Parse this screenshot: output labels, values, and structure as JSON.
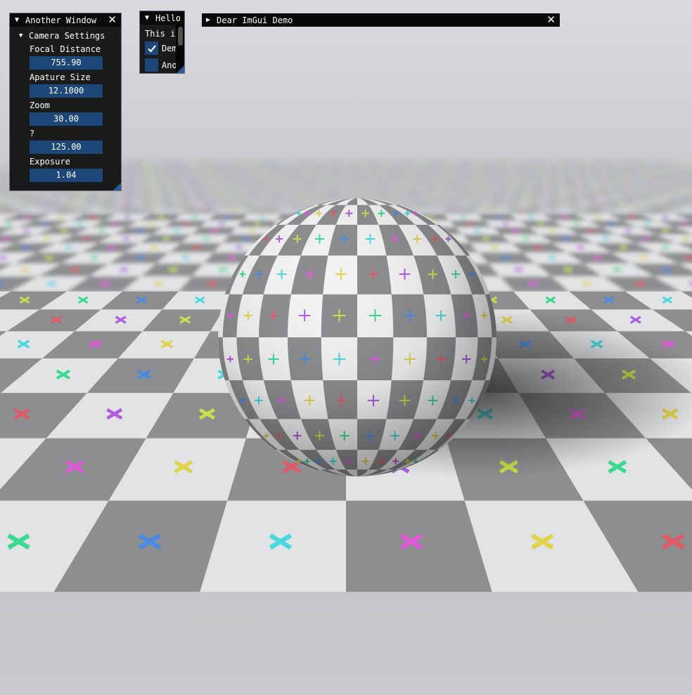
{
  "windows": {
    "another": {
      "title": "Another Window",
      "close_glyph": "✕",
      "tree": {
        "label": "Camera Settings",
        "expanded": true
      },
      "fields": [
        {
          "label": "Focal Distance",
          "value": "755.90"
        },
        {
          "label": "Apature Size",
          "value": "12.1000"
        },
        {
          "label": "Zoom",
          "value": "30.00"
        },
        {
          "label": "?",
          "value": "125.00"
        },
        {
          "label": "Exposure",
          "value": "1.04"
        }
      ]
    },
    "hello": {
      "title": "Hello,",
      "text": "This i",
      "checkboxes": [
        {
          "label": "Dem",
          "checked": true
        },
        {
          "label": "Ano",
          "checked": false
        }
      ]
    },
    "demo": {
      "title": "Dear ImGui Demo",
      "close_glyph": "✕",
      "collapsed": true
    }
  },
  "colors": {
    "window_bg": "#0f0f0f",
    "title_bg": "#0a0a0a",
    "title_bg_active": "#294a7a",
    "frame_bg": "#1d4778",
    "border": "#6e6e80",
    "checkmark": "#4296fa"
  }
}
